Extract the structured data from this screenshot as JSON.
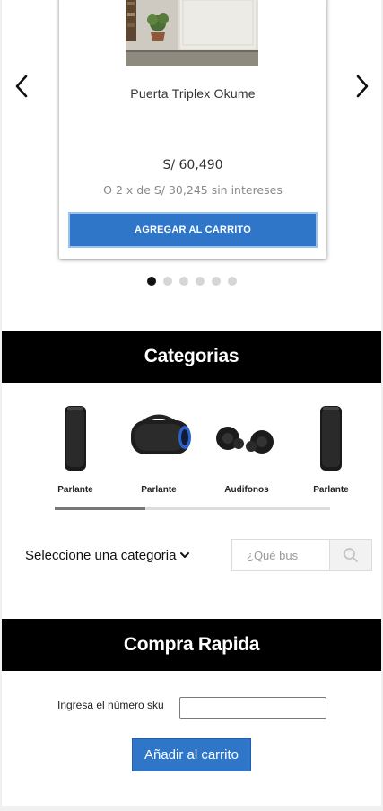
{
  "carousel": {
    "product": {
      "name": "Puerta Triplex Okume",
      "price": "S/ 60,490",
      "installments": "O 2 x de S/ 30,245 sin intereses",
      "add_to_cart_label": "AGREGAR AL CARRITO"
    },
    "prev_icon": "chevron-left-icon",
    "next_icon": "chevron-right-icon",
    "dots_total": 6,
    "active_dot": 1
  },
  "categories_section": {
    "title": "Categorias",
    "items": [
      {
        "label": "Parlante",
        "icon": "tall-speaker"
      },
      {
        "label": "Parlante",
        "icon": "boombox-speaker"
      },
      {
        "label": "Audifonos",
        "icon": "wireless-earbuds"
      },
      {
        "label": "Parlante",
        "icon": "tall-speaker"
      }
    ],
    "scroll_progress": 0.33
  },
  "filter": {
    "category_select_label": "Seleccione una categoria",
    "search_placeholder": "¿Qué bus",
    "search_value": ""
  },
  "quick_buy": {
    "title": "Compra Rapida",
    "sku_label": "Ingresa el número sku",
    "sku_value": "",
    "add_button_label": "Añadir al carrito"
  },
  "colors": {
    "accent_blue": "#2f76c9",
    "section_bar": "#000000"
  }
}
